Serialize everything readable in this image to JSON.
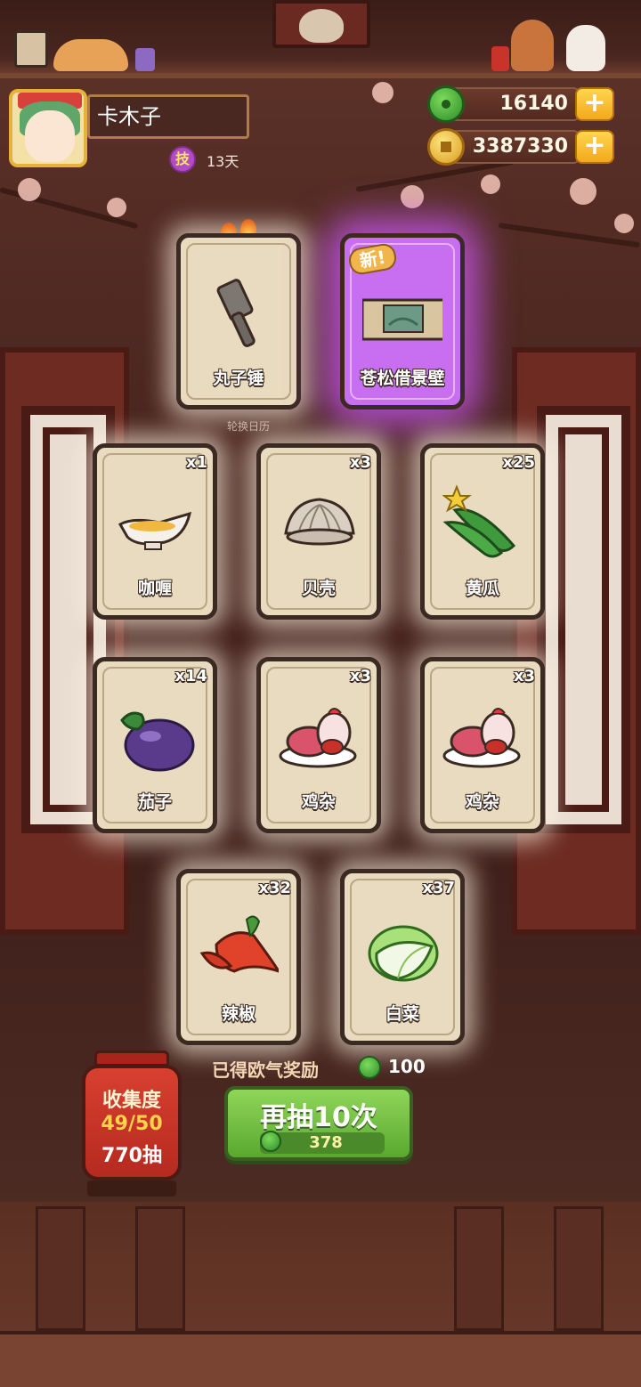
{
  "player": {
    "name": "卡木子",
    "skill_badge": "技",
    "skill_days": "13天"
  },
  "currencies": {
    "jade": "16140",
    "gold": "3387330"
  },
  "hint": "轮换日历",
  "new_tag": "新!",
  "cards": [
    {
      "label": "丸子锤",
      "count": "",
      "icon": "mallet-icon"
    },
    {
      "label": "苍松借景壁",
      "count": "",
      "icon": "landscape-screen-icon",
      "rare": true
    },
    {
      "label": "咖喱",
      "count": "x1",
      "icon": "curry-gravy-boat-icon"
    },
    {
      "label": "贝壳",
      "count": "x3",
      "icon": "clam-shell-icon"
    },
    {
      "label": "黄瓜",
      "count": "x25",
      "icon": "cucumber-icon"
    },
    {
      "label": "茄子",
      "count": "x14",
      "icon": "eggplant-icon"
    },
    {
      "label": "鸡杂",
      "count": "x3",
      "icon": "chicken-giblets-icon"
    },
    {
      "label": "鸡杂",
      "count": "x3",
      "icon": "chicken-giblets-icon"
    },
    {
      "label": "辣椒",
      "count": "x32",
      "icon": "chili-pepper-icon"
    },
    {
      "label": "白菜",
      "count": "x37",
      "icon": "napa-cabbage-icon"
    }
  ],
  "reward": {
    "text": "已得欧气奖励",
    "value": "100"
  },
  "draw_button": {
    "label": "再抽10次",
    "cost": "378"
  },
  "collection": {
    "title": "收集度",
    "progress": "49/50",
    "draws": "770抽"
  }
}
